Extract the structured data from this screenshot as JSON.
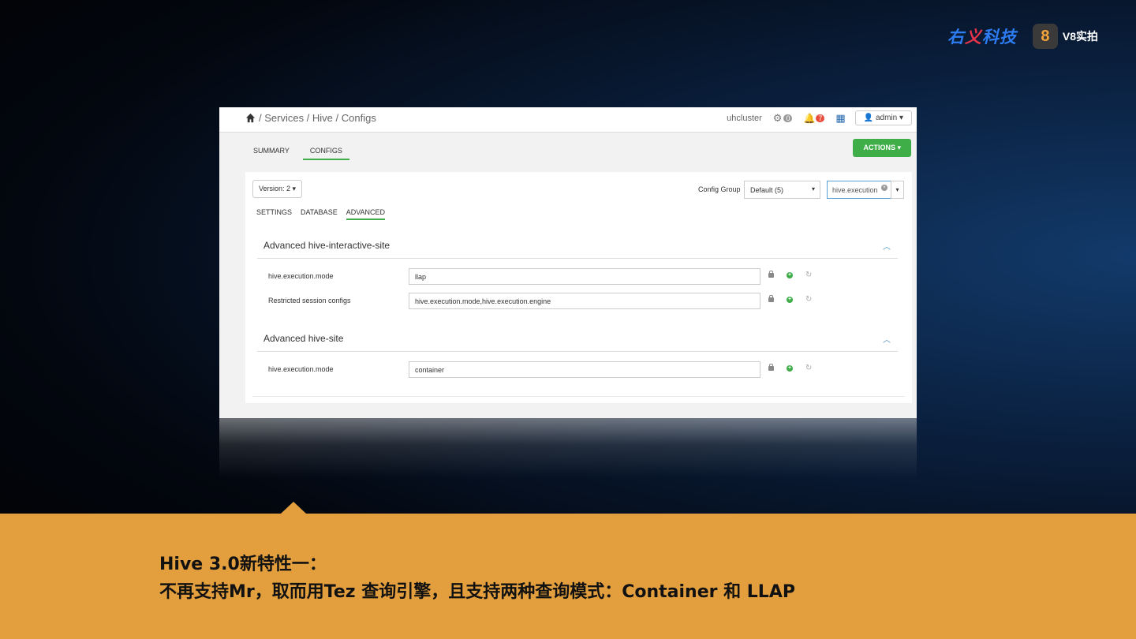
{
  "brand": {
    "logo_part1": "右",
    "logo_part2": "义",
    "logo_part3": "科技",
    "v8_badge": "8",
    "v8_text": "V8实拍"
  },
  "topbar": {
    "breadcrumb": "/ Services / Hive / Configs",
    "cluster": "uhcluster",
    "gear_count": "0",
    "alert_count": "7",
    "user_button": "admin ▾"
  },
  "subnav": {
    "tabs": [
      "SUMMARY",
      "CONFIGS"
    ],
    "actions_label": "ACTIONS ▾"
  },
  "panel": {
    "version_label": "Version:  2 ▾",
    "config_group_label": "Config Group",
    "config_group_value": "Default (5)",
    "filter_value": "hive.execution",
    "tabs": [
      "SETTINGS",
      "DATABASE",
      "ADVANCED"
    ]
  },
  "sections": [
    {
      "title": "Advanced hive-interactive-site",
      "rows": [
        {
          "label": "hive.execution.mode",
          "value": "llap"
        },
        {
          "label": "Restricted session configs",
          "value": "hive.execution.mode,hive.execution.engine"
        }
      ]
    },
    {
      "title": "Advanced hive-site",
      "rows": [
        {
          "label": "hive.execution.mode",
          "value": "container"
        }
      ]
    }
  ],
  "caption": {
    "line1": "Hive 3.0新特性一：",
    "line2": "不再支持Mr，取而用Tez 查询引擎，且支持两种查询模式：Container 和 LLAP"
  },
  "colors": {
    "accent_green": "#3fae49",
    "caption_bg": "#e39f3e",
    "alert_red": "#e74c3c"
  }
}
